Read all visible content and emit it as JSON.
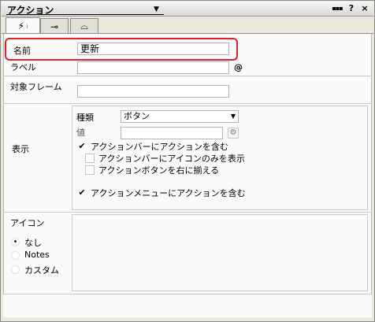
{
  "window": {
    "title": "アクション",
    "buttons": {
      "menu": "▪▪▪",
      "help": "?",
      "close": "×"
    }
  },
  "tabs": [
    {
      "icon": "lightning-icon",
      "glyph": "⚡",
      "active": true
    },
    {
      "icon": "link-tool-icon",
      "glyph": "⊸",
      "active": false
    },
    {
      "icon": "script-icon",
      "glyph": "⌓",
      "active": false
    }
  ],
  "form": {
    "name": {
      "label": "名前",
      "value": "更新"
    },
    "label_field": {
      "label": "ラベル",
      "value": "",
      "at": "@"
    },
    "target_frame": {
      "label": "対象フレーム",
      "value": ""
    },
    "display": {
      "label": "表示",
      "type_label": "種類",
      "type_value": "ボタン",
      "value_label": "値",
      "value_value": "",
      "checkbox_include_in_bar": {
        "label": "アクションバーにアクションを含む",
        "checked": true
      },
      "checkbox_icon_only": {
        "label": "アクションバーにアイコンのみを表示",
        "checked": false
      },
      "checkbox_align_right": {
        "label": "アクションボタンを右に揃える",
        "checked": false
      },
      "checkbox_include_in_menu": {
        "label": "アクションメニューにアクションを含む",
        "checked": true
      }
    },
    "icon": {
      "label": "アイコン",
      "options": [
        "なし",
        "Notes",
        "カスタム"
      ],
      "selected": "なし"
    }
  },
  "colors": {
    "highlight": "#e0202a",
    "panel": "#fafaf8",
    "chrome": "#ece9d8"
  }
}
